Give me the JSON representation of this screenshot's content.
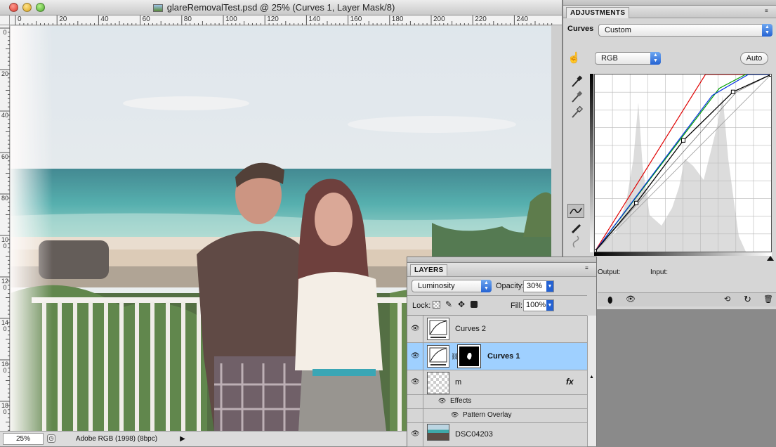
{
  "window": {
    "title": "glareRemovalTest.psd @ 25% (Curves 1, Layer Mask/8)"
  },
  "rulers": {
    "horizontal": [
      "0",
      "20",
      "40",
      "60",
      "80",
      "100",
      "120",
      "140",
      "160",
      "180",
      "200",
      "220",
      "240"
    ],
    "vertical": [
      "0",
      "20",
      "40",
      "60",
      "80",
      "100",
      "120",
      "140",
      "160",
      "180"
    ]
  },
  "status": {
    "zoom": "25%",
    "profile": "Adobe RGB (1998) (8bpc)"
  },
  "adjustments": {
    "tab": "ADJUSTMENTS",
    "label": "Curves",
    "preset": "Custom",
    "channel": "RGB",
    "auto_label": "Auto",
    "output_label": "Output:",
    "input_label": "Input:"
  },
  "curves": {
    "domain": [
      0,
      255
    ],
    "rgb_curve": [
      [
        0,
        0
      ],
      [
        60,
        70
      ],
      [
        128,
        160
      ],
      [
        200,
        230
      ],
      [
        255,
        255
      ]
    ],
    "red_curve": [
      [
        0,
        0
      ],
      [
        160,
        255
      ],
      [
        255,
        255
      ]
    ],
    "green_curve": [
      [
        0,
        0
      ],
      [
        180,
        235
      ],
      [
        218,
        255
      ],
      [
        255,
        255
      ]
    ],
    "blue_curve": [
      [
        0,
        0
      ],
      [
        170,
        225
      ],
      [
        222,
        255
      ],
      [
        255,
        255
      ]
    ],
    "composite_curve": [
      [
        0,
        0
      ],
      [
        205,
        230
      ],
      [
        255,
        255
      ]
    ]
  },
  "layers": {
    "tab": "LAYERS",
    "blend_mode": "Luminosity",
    "opacity_label": "Opacity:",
    "opacity": "30%",
    "lock_label": "Lock:",
    "fill_label": "Fill:",
    "fill": "100%",
    "items": [
      {
        "name": "Curves 2",
        "type": "curves"
      },
      {
        "name": "Curves 1",
        "type": "curves",
        "selected": true
      },
      {
        "name": "m",
        "type": "pixel",
        "fx": "fx"
      },
      {
        "name": "Effects",
        "type": "effects"
      },
      {
        "name": "Pattern Overlay",
        "type": "effect"
      },
      {
        "name": "DSC04203",
        "type": "photo"
      }
    ]
  },
  "colors": {
    "selection": "#9fd0ff",
    "accent_blue": "#2462d3"
  }
}
